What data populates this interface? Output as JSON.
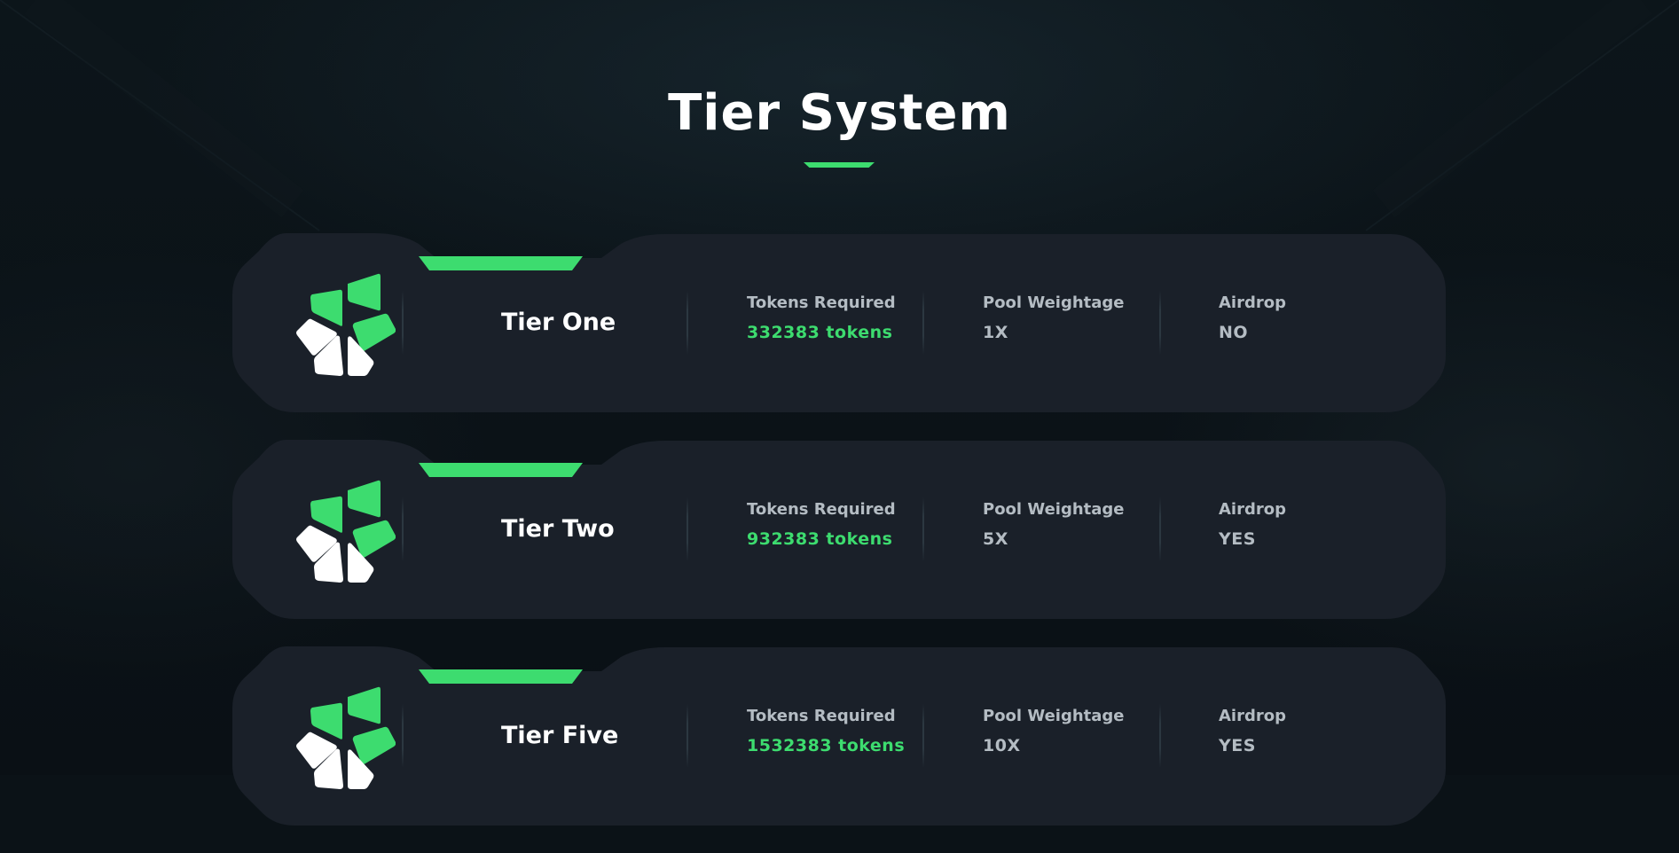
{
  "page": {
    "title": "Tier System"
  },
  "colors": {
    "accent": "#3ddc6f",
    "card": "#1a2029",
    "background": "#0b1217",
    "muted_text": "#b4bcc3"
  },
  "icons": {
    "tier": "pentagon-petal-logo-icon"
  },
  "tiers": [
    {
      "name": "Tier One",
      "tokens_label": "Tokens Required",
      "tokens_value": "332383 tokens",
      "pool_label": "Pool Weightage",
      "pool_value": "1X",
      "airdrop_label": "Airdrop",
      "airdrop_value": "NO"
    },
    {
      "name": "Tier Two",
      "tokens_label": "Tokens Required",
      "tokens_value": "932383 tokens",
      "pool_label": "Pool Weightage",
      "pool_value": "5X",
      "airdrop_label": "Airdrop",
      "airdrop_value": "YES"
    },
    {
      "name": "Tier Five",
      "tokens_label": "Tokens Required",
      "tokens_value": "1532383 tokens",
      "pool_label": "Pool Weightage",
      "pool_value": "10X",
      "airdrop_label": "Airdrop",
      "airdrop_value": "YES"
    }
  ]
}
